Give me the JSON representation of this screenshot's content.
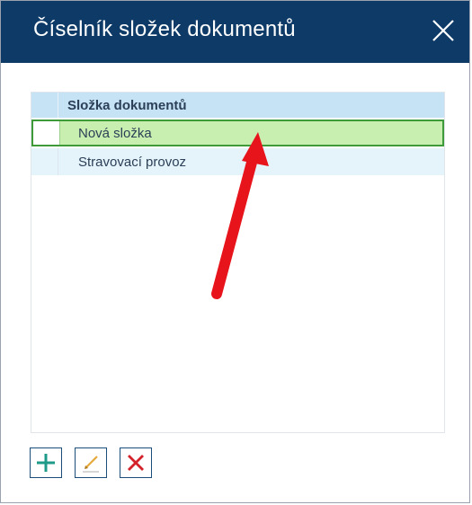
{
  "window": {
    "title": "Číselník složek dokumentů"
  },
  "grid": {
    "columns": [
      "Složka dokumentů"
    ],
    "rows": [
      {
        "label": "Nová složka",
        "selected": true
      },
      {
        "label": "Stravovací provoz",
        "selected": false
      }
    ]
  },
  "toolbar": {
    "buttons": [
      {
        "icon": "plus-icon",
        "action": "add"
      },
      {
        "icon": "pencil-icon",
        "action": "edit"
      },
      {
        "icon": "x-icon",
        "action": "delete"
      }
    ]
  },
  "colors": {
    "titlebar": "#0d3a66",
    "header": "#c6e2f5",
    "selected_row": "#c9efb0",
    "selected_border": "#3f9a3a",
    "alt_row": "#e5f3fb",
    "annotation_arrow": "#e8141c",
    "add_icon": "#1e9a8a",
    "delete_icon": "#d4222a"
  }
}
